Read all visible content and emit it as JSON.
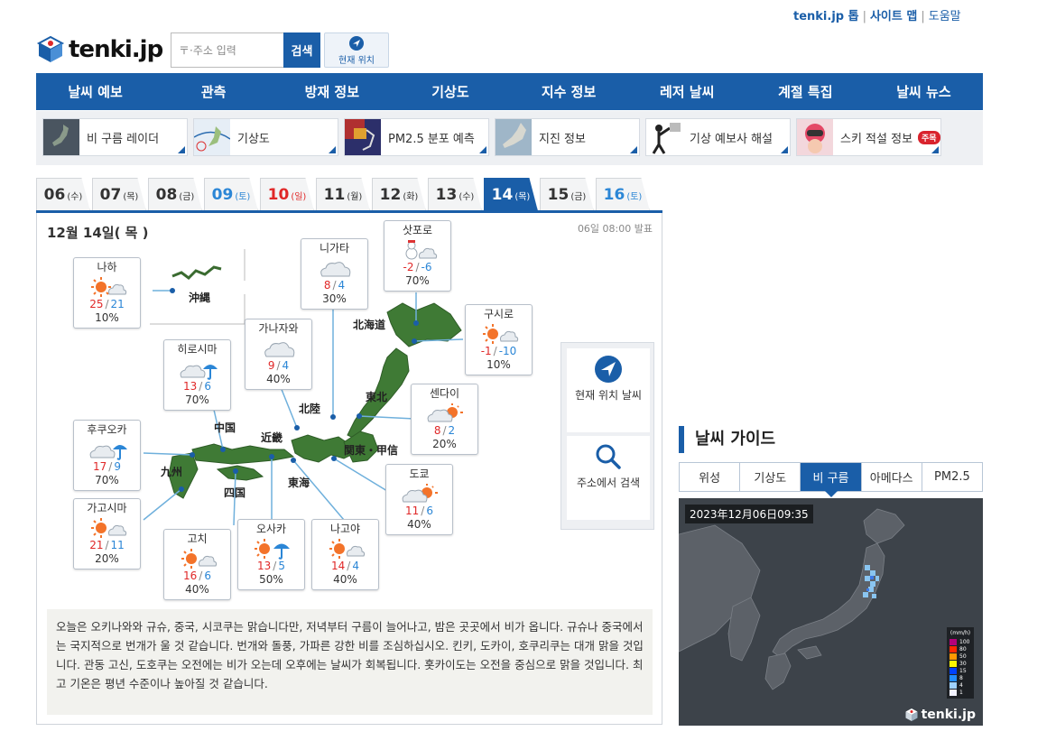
{
  "toplinks": {
    "top": "tenki.jp 톱",
    "sitemap": "사이트 맵",
    "help": "도움말"
  },
  "logo": {
    "text": "tenki.jp"
  },
  "search": {
    "placeholder": "〒·주소 입력",
    "button": "검색"
  },
  "current_location": {
    "label": "현재 위치"
  },
  "mainnav": [
    "날씨 예보",
    "관측",
    "방재 정보",
    "기상도",
    "지수 정보",
    "레저 날씨",
    "계절 특집",
    "날씨 뉴스"
  ],
  "subnav": [
    {
      "label": "비 구름 레이더"
    },
    {
      "label": "기상도"
    },
    {
      "label": "PM2.5 분포 예측"
    },
    {
      "label": "지진 정보"
    },
    {
      "label": "기상 예보사 해설"
    },
    {
      "label": "스키 적설 정보",
      "badge": "주목"
    }
  ],
  "date_tabs": [
    {
      "day": "06",
      "wd": "(수)"
    },
    {
      "day": "07",
      "wd": "(목)"
    },
    {
      "day": "08",
      "wd": "(금)"
    },
    {
      "day": "09",
      "wd": "(토)"
    },
    {
      "day": "10",
      "wd": "(일)"
    },
    {
      "day": "11",
      "wd": "(월)"
    },
    {
      "day": "12",
      "wd": "(화)"
    },
    {
      "day": "13",
      "wd": "(수)"
    },
    {
      "day": "14",
      "wd": "(목)"
    },
    {
      "day": "15",
      "wd": "(금)"
    },
    {
      "day": "16",
      "wd": "(토)"
    }
  ],
  "panel": {
    "date": "12월 14일( 목 )",
    "issued": "06일 08:00 발표",
    "regions": {
      "okinawa": "沖縄",
      "hokkaido": "北海道",
      "tohoku": "東北",
      "hokuriku": "北陸",
      "kanto": "関東・甲信",
      "kinki": "近畿",
      "tokai": "東海",
      "chugoku": "中国",
      "shikoku": "四国",
      "kyushu": "九州"
    },
    "cities": {
      "naha": {
        "name": "나하",
        "hi": "25",
        "lo": "21",
        "pop": "10%"
      },
      "niigata": {
        "name": "니가타",
        "hi": "8",
        "lo": "4",
        "pop": "30%"
      },
      "sapporo": {
        "name": "삿포로",
        "hi": "-2",
        "lo": "-6",
        "pop": "70%"
      },
      "kushiro": {
        "name": "구시로",
        "hi": "-1",
        "lo": "-10",
        "pop": "10%"
      },
      "kanazawa": {
        "name": "가나자와",
        "hi": "9",
        "lo": "4",
        "pop": "40%"
      },
      "hiroshima": {
        "name": "히로시마",
        "hi": "13",
        "lo": "6",
        "pop": "70%"
      },
      "sendai": {
        "name": "센다이",
        "hi": "8",
        "lo": "2",
        "pop": "20%"
      },
      "fukuoka": {
        "name": "후쿠오카",
        "hi": "17",
        "lo": "9",
        "pop": "70%"
      },
      "tokyo": {
        "name": "도쿄",
        "hi": "11",
        "lo": "6",
        "pop": "40%"
      },
      "kagoshima": {
        "name": "가고시마",
        "hi": "21",
        "lo": "11",
        "pop": "20%"
      },
      "kochi": {
        "name": "고치",
        "hi": "16",
        "lo": "6",
        "pop": "40%"
      },
      "osaka": {
        "name": "오사카",
        "hi": "13",
        "lo": "5",
        "pop": "50%"
      },
      "nagoya": {
        "name": "나고야",
        "hi": "14",
        "lo": "4",
        "pop": "40%"
      }
    },
    "side": {
      "current": "현재 위치 날씨",
      "address": "주소에서 검색"
    },
    "comment": "오늘은 오키나와와 규슈, 중국, 시코쿠는 맑습니다만, 저녁부터 구름이 늘어나고, 밤은 곳곳에서 비가 옵니다. 규슈나 중국에서는 국지적으로 번개가 울 것 같습니다. 번개와 돌풍, 가파른 강한 비를 조심하십시오. 킨키, 도카이, 호쿠리쿠는 대개 맑을 것입니다. 관동 고신, 도호쿠는 오전에는 비가 오는데 오후에는 날씨가 회복됩니다. 홋카이도는 오전을 중심으로 맑을 것입니다. 최고 기온은 평년 수준이나 높아질 것 같습니다."
  },
  "guide": {
    "title": "날씨 가이드",
    "tabs": [
      "위성",
      "기상도",
      "비 구름",
      "아메다스",
      "PM2.5"
    ],
    "timestamp": "2023年12月06日09:35",
    "legend_unit": "(mm/h)",
    "legend": [
      "100",
      "80",
      "50",
      "30",
      "15",
      "8",
      "4",
      "1"
    ],
    "brand": "tenki.jp"
  }
}
